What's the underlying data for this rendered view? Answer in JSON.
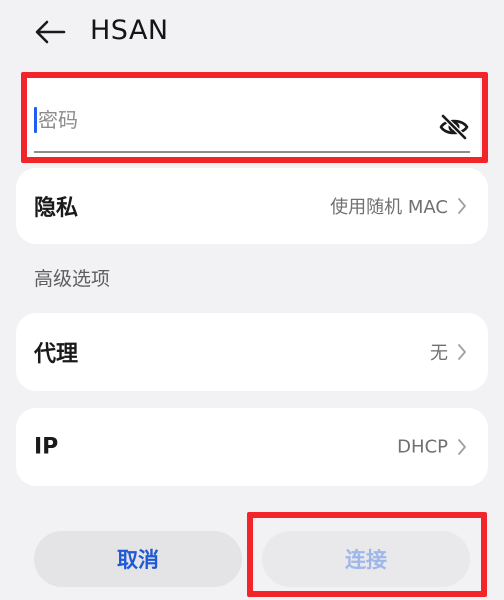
{
  "header": {
    "title": "HSAN",
    "back_icon": "back-arrow-icon"
  },
  "password": {
    "placeholder": "密码",
    "visibility_icon": "eye-slash-icon"
  },
  "privacy": {
    "label": "隐私",
    "value": "使用随机 MAC"
  },
  "advanced": {
    "section_title": "高级选项",
    "proxy": {
      "label": "代理",
      "value": "无"
    },
    "ip": {
      "label": "IP",
      "value": "DHCP"
    }
  },
  "actions": {
    "cancel_label": "取消",
    "connect_label": "连接"
  },
  "colors": {
    "accent": "#1f5ad6",
    "disabled_accent": "#9fb6ea",
    "highlight": "#f2262a",
    "background": "#f2f2f4"
  }
}
